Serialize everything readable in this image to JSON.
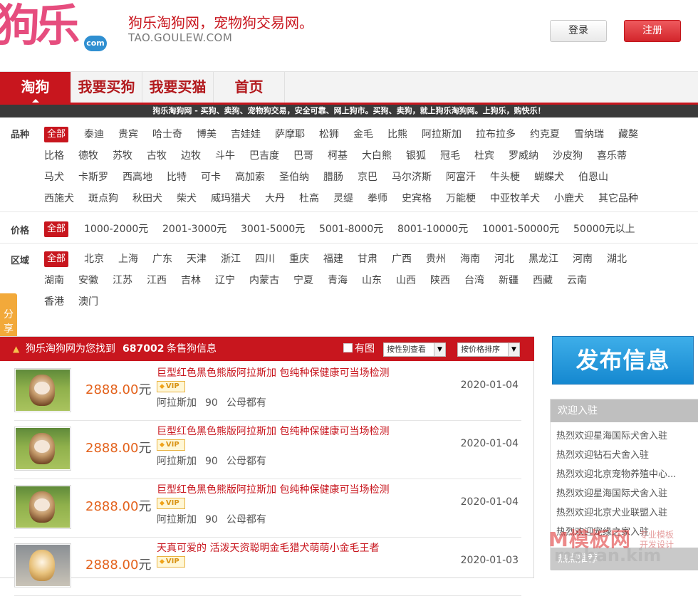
{
  "header": {
    "logo_text": "狗乐",
    "logo_badge": "com",
    "slogan": "狗乐淘狗网，宠物狗交易网。",
    "domain": "TAO.GOULEW.COM",
    "login_label": "登录",
    "register_label": "注册"
  },
  "nav": {
    "tabs": [
      {
        "label": "淘狗"
      },
      {
        "label": "我要买狗"
      },
      {
        "label": "我要买猫"
      },
      {
        "label": "首页"
      }
    ]
  },
  "notice": "狗乐淘狗网 - 买狗、卖狗、宠物狗交易，安全可靠、网上狗市。买狗、卖狗，就上狗乐淘狗网。上狗乐，购快乐！",
  "filters": {
    "breed": {
      "label": "品种",
      "options": [
        "全部",
        "泰迪",
        "贵宾",
        "哈士奇",
        "博美",
        "吉娃娃",
        "萨摩耶",
        "松狮",
        "金毛",
        "比熊",
        "阿拉斯加",
        "拉布拉多",
        "约克夏",
        "雪纳瑞",
        "藏獒",
        "比格",
        "德牧",
        "苏牧",
        "古牧",
        "边牧",
        "斗牛",
        "巴吉度",
        "巴哥",
        "柯基",
        "大白熊",
        "银狐",
        "冠毛",
        "杜宾",
        "罗威纳",
        "沙皮狗",
        "喜乐蒂",
        "马犬",
        "卡斯罗",
        "西高地",
        "比特",
        "可卡",
        "高加索",
        "圣伯纳",
        "腊肠",
        "京巴",
        "马尔济斯",
        "阿富汗",
        "牛头梗",
        "蝴蝶犬",
        "伯恩山",
        "西施犬",
        "斑点狗",
        "秋田犬",
        "柴犬",
        "威玛猎犬",
        "大丹",
        "杜高",
        "灵缇",
        "拳师",
        "史宾格",
        "万能梗",
        "中亚牧羊犬",
        "小鹿犬",
        "其它品种"
      ]
    },
    "price": {
      "label": "价格",
      "options": [
        "全部",
        "1000-2000元",
        "2001-3000元",
        "3001-5000元",
        "5001-8000元",
        "8001-10000元",
        "10001-50000元",
        "50000元以上"
      ]
    },
    "region": {
      "label": "区域",
      "options": [
        "全部",
        "北京",
        "上海",
        "广东",
        "天津",
        "浙江",
        "四川",
        "重庆",
        "福建",
        "甘肃",
        "广西",
        "贵州",
        "海南",
        "河北",
        "黑龙江",
        "河南",
        "湖北",
        "湖南",
        "安徽",
        "江苏",
        "江西",
        "吉林",
        "辽宁",
        "内蒙古",
        "宁夏",
        "青海",
        "山东",
        "山西",
        "陕西",
        "台湾",
        "新疆",
        "西藏",
        "云南",
        "香港",
        "澳门"
      ]
    }
  },
  "share_label": "分享",
  "listing": {
    "found_prefix": "狗乐淘狗网为您找到",
    "count": "687002",
    "found_suffix": "条售狗信息",
    "has_image_label": "有图",
    "sort_sex": "按性别查看",
    "sort_price": "按价格排序",
    "items": [
      {
        "title": "巨型红色黑色熊版阿拉斯加 包纯种保健康可当场检测",
        "price": "2888.00",
        "unit": "元",
        "vip": "VIP",
        "breed": "阿拉斯加",
        "age": "90",
        "gender": "公母都有",
        "date": "2020-01-04"
      },
      {
        "title": "巨型红色黑色熊版阿拉斯加 包纯种保健康可当场检测",
        "price": "2888.00",
        "unit": "元",
        "vip": "VIP",
        "breed": "阿拉斯加",
        "age": "90",
        "gender": "公母都有",
        "date": "2020-01-04"
      },
      {
        "title": "巨型红色黑色熊版阿拉斯加 包纯种保健康可当场检测",
        "price": "2888.00",
        "unit": "元",
        "vip": "VIP",
        "breed": "阿拉斯加",
        "age": "90",
        "gender": "公母都有",
        "date": "2020-01-04"
      },
      {
        "title": "天真可爱的 活泼天资聪明金毛猎犬萌萌小金毛王者",
        "price": "2888.00",
        "unit": "元",
        "vip": "VIP",
        "breed": "",
        "age": "",
        "gender": "",
        "date": "2020-01-03"
      }
    ]
  },
  "sidebar": {
    "publish_label": "发布信息",
    "welcome_title": "欢迎入驻",
    "welcome_items": [
      "热烈欢迎星海国际犬舍入驻",
      "热烈欢迎钻石犬舍入驻",
      "热烈欢迎北京宠物养殖中心...",
      "热烈欢迎星海国际犬舍入驻",
      "热烈欢迎北京犬业联盟入驻",
      "热烈欢迎宠缘之家入驻"
    ],
    "hot_title": "热点推荐"
  },
  "watermark": {
    "line1": "M模板网",
    "line2": "moban.kim",
    "tag1": "专业模板",
    "tag2": "开发设计"
  },
  "colors": {
    "brand_red": "#c8161e",
    "price_orange": "#e3621c",
    "publish_blue": "#1588d0",
    "logo_pink": "#e64d7e"
  }
}
